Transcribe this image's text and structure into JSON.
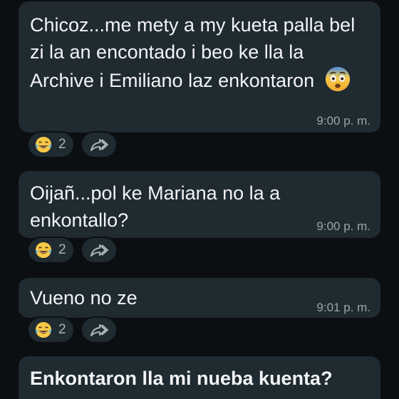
{
  "messages": [
    {
      "text": "Chicoz...me mety a my kueta palla bel zi la an encontado i beo ke lla la Archive i Emiliano laz enkontaron",
      "trailing_emoji": "fearful-face-emoji",
      "time": "9:00 p. m.",
      "reaction_emoji": "laughing-tears-emoji",
      "reaction_count": "2"
    },
    {
      "text": "Oijañ...pol ke Mariana no la a enkontallo?",
      "time": "9:00 p. m.",
      "reaction_emoji": "laughing-tears-emoji",
      "reaction_count": "2"
    },
    {
      "text": "Vueno no ze",
      "time": "9:01 p. m.",
      "reaction_emoji": "laughing-tears-emoji",
      "reaction_count": "2"
    },
    {
      "text": "Enkontaron lla mi nueba kuenta?"
    }
  ],
  "colors": {
    "background": "#0b0f12",
    "bubble": "#1f2a31",
    "text": "#f2f4f5",
    "timestamp": "#9aa5ab"
  },
  "icons": {
    "forward": "forward-icon"
  }
}
